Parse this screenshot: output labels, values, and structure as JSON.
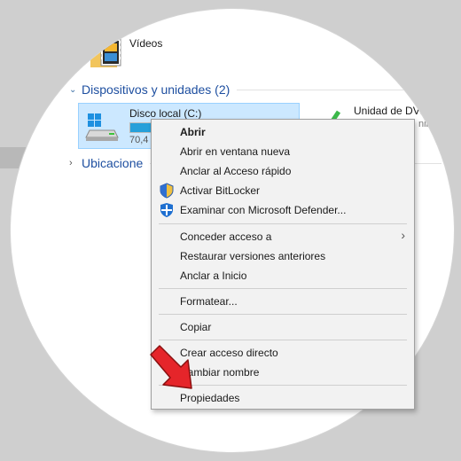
{
  "explorer": {
    "videos_label": "Vídeos",
    "devices_header": "Dispositivos y unidades (2)",
    "disk_label": "Disco local (C:)",
    "disk_free": "70,4",
    "disk_usage_fraction": 0.34,
    "dvd_label": "Unidad de DVD",
    "dvd_sub": "nib",
    "locations_header": "Ubicacione"
  },
  "menu": {
    "open": "Abrir",
    "open_new_window": "Abrir en ventana nueva",
    "pin_quick_access": "Anclar al Acceso rápido",
    "bitlocker": "Activar BitLocker",
    "defender": "Examinar con Microsoft Defender...",
    "grant_access": "Conceder acceso a",
    "restore_versions": "Restaurar versiones anteriores",
    "pin_start": "Anclar a Inicio",
    "format": "Formatear...",
    "copy": "Copiar",
    "create_shortcut": "Crear acceso directo",
    "rename": "Cambiar nombre",
    "properties": "Propiedades"
  },
  "colors": {
    "accent": "#26a0da",
    "selection": "#cce8ff",
    "arrow": "#e5252a"
  },
  "icons": {
    "videos": "videos-folder-icon",
    "disk": "local-disk-icon",
    "dvd": "dvd-drive-icon",
    "bitlocker": "shield-icon",
    "defender": "defender-icon",
    "submenu": "chevron-right-icon",
    "pointer": "red-arrow-icon"
  }
}
